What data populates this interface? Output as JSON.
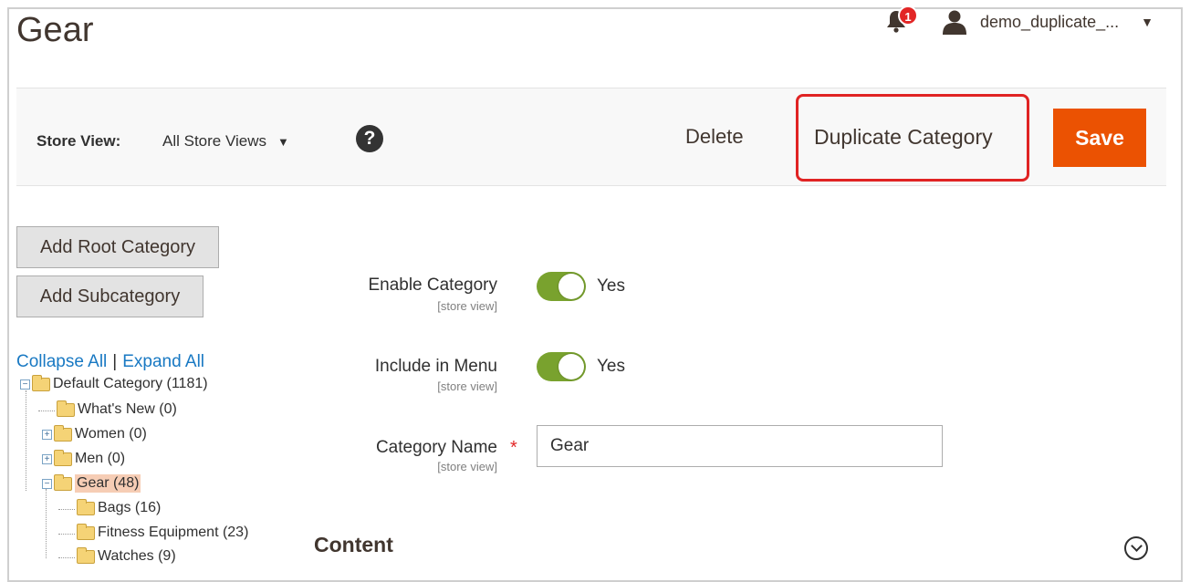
{
  "header": {
    "title": "Gear",
    "notifications_count": "1",
    "user_name": "demo_duplicate_...",
    "user_caret": "▼"
  },
  "toolbar": {
    "store_view_label": "Store View:",
    "store_view_value": "All Store Views",
    "store_view_caret": "▼",
    "help_label": "?",
    "delete_label": "Delete",
    "duplicate_label": "Duplicate Category",
    "save_label": "Save",
    "highlight_color": "#e02323",
    "save_color": "#eb5202"
  },
  "sidebar": {
    "add_root_label": "Add Root Category",
    "add_sub_label": "Add Subcategory",
    "collapse_all": "Collapse All",
    "separator": "|",
    "expand_all": "Expand All",
    "tree": [
      {
        "label": "Default Category (1181)",
        "expander": "⊟"
      },
      {
        "label": "What's New (0)",
        "expander": ""
      },
      {
        "label": "Women (0)",
        "expander": "⊞"
      },
      {
        "label": "Men (0)",
        "expander": "⊞"
      },
      {
        "label": "Gear (48)",
        "expander": "⊟",
        "selected": true
      },
      {
        "label": "Bags (16)",
        "expander": ""
      },
      {
        "label": "Fitness Equipment (23)",
        "expander": ""
      },
      {
        "label": "Watches (9)",
        "expander": ""
      }
    ]
  },
  "form": {
    "enable_category": {
      "label": "Enable Category",
      "scope": "[store view]",
      "value": "Yes"
    },
    "include_in_menu": {
      "label": "Include in Menu",
      "scope": "[store view]",
      "value": "Yes"
    },
    "category_name": {
      "label": "Category Name",
      "scope": "[store view]",
      "required": "*",
      "value": "Gear"
    },
    "toggle_color": "#79a22e"
  },
  "content_section": {
    "title": "Content"
  }
}
